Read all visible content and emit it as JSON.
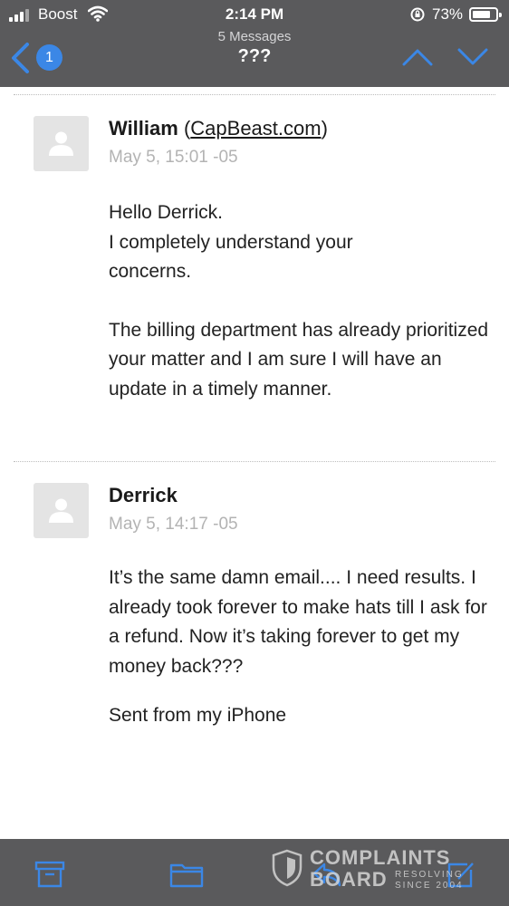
{
  "status_bar": {
    "carrier": "Boost",
    "time": "2:14 PM",
    "battery_percent": "73%"
  },
  "nav": {
    "back_badge": "1",
    "message_count": "5 Messages",
    "subject": "???"
  },
  "messages": [
    {
      "sender": "William",
      "sender_domain_open": "(",
      "sender_domain": "CapBeast.com",
      "sender_domain_close": ")",
      "date": "May 5, 15:01 -05",
      "body": [
        "Hello Derrick.",
        "I completely understand your concerns.",
        "",
        "The billing department has already prioritized your matter and I am sure I will have an update in a timely manner."
      ]
    },
    {
      "sender": "Derrick",
      "date": "May 5, 14:17 -05",
      "body": [
        "It’s the same damn email.... I need results. I already took forever to make hats till I ask for a refund. Now it’s taking forever to get my money back???",
        "",
        "Sent from my iPhone"
      ]
    }
  ],
  "watermark": {
    "line1": "COMPLAINTS",
    "line2": "BOARD",
    "tag1": "RESOLVING",
    "tag2": "SINCE 2004"
  },
  "colors": {
    "bar_background": "#5a5a5c",
    "accent": "#3b87e6"
  },
  "icons": {
    "toolbar": [
      "archive-icon",
      "folder-icon",
      "reply-icon",
      "compose-icon"
    ]
  }
}
